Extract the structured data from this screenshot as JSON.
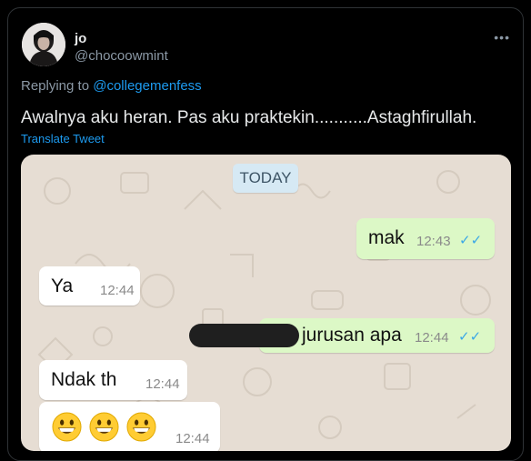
{
  "tweet": {
    "name": "jo",
    "handle": "@chocoowmint",
    "more": "•••",
    "replying_prefix": "Replying to ",
    "replying_to": "@collegemenfess",
    "text": "Awalnya aku heran. Pas aku praktekin...........Astaghfirullah.",
    "translate": "Translate Tweet"
  },
  "chat": {
    "date_label": "TODAY",
    "messages": [
      {
        "side": "out",
        "text": "mak",
        "time": "12:43",
        "ticks": "✓✓"
      },
      {
        "side": "in",
        "text": "Ya",
        "time": "12:44"
      },
      {
        "side": "out",
        "text": "jurusan apa",
        "time": "12:44",
        "ticks": "✓✓"
      },
      {
        "side": "in",
        "text": "Ndak th",
        "time": "12:44"
      },
      {
        "side": "in",
        "emoji": "grinning-face x3",
        "time": "12:44"
      }
    ]
  },
  "colors": {
    "background": "#000000",
    "link": "#1d9bf0",
    "outgoing_bubble": "#dcf8c6",
    "incoming_bubble": "#ffffff",
    "chat_wallpaper": "#e6ddd3",
    "read_ticks": "#3aa7e6"
  }
}
